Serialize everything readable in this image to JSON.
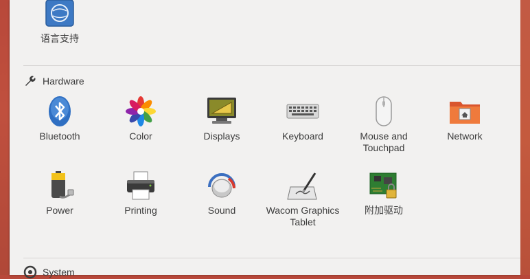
{
  "top_item": {
    "label": "语言支持"
  },
  "sections": {
    "hardware": {
      "title": "Hardware"
    },
    "system": {
      "title": "System"
    }
  },
  "hardware_items": [
    {
      "label": "Bluetooth"
    },
    {
      "label": "Color"
    },
    {
      "label": "Displays"
    },
    {
      "label": "Keyboard"
    },
    {
      "label": "Mouse and Touchpad"
    },
    {
      "label": "Network"
    },
    {
      "label": "Power"
    },
    {
      "label": "Printing"
    },
    {
      "label": "Sound"
    },
    {
      "label": "Wacom Graphics Tablet"
    },
    {
      "label": "附加驱动"
    }
  ],
  "colors": {
    "panel": "#f2f1f0",
    "text": "#3c3c3c",
    "desktop": "#b8483a"
  }
}
